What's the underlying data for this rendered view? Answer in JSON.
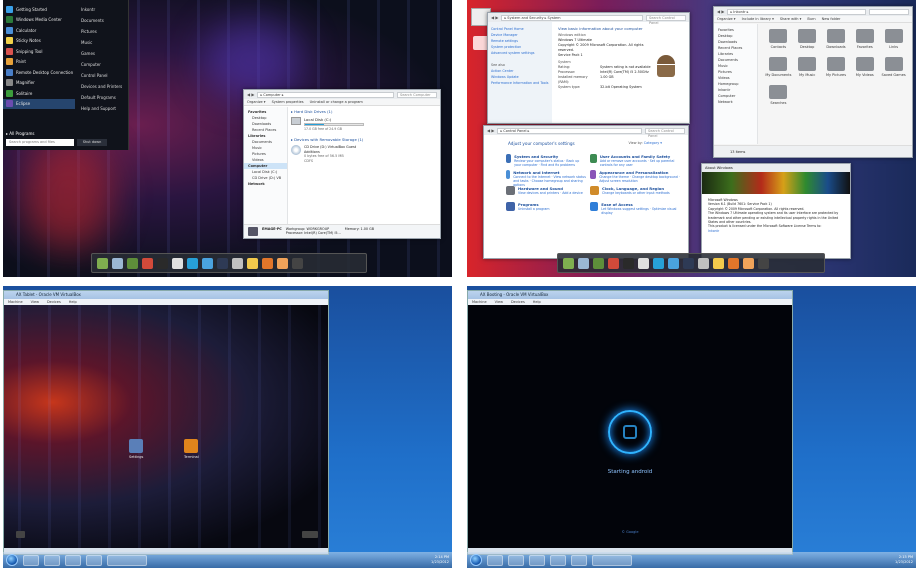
{
  "panel1": {
    "start_menu": {
      "left_items": [
        "Getting Started",
        "Windows Media Center",
        "Calculator",
        "Sticky Notes",
        "Snipping Tool",
        "Paint",
        "Remote Desktop Connection",
        "Magnifier",
        "Solitaire",
        "Eclipse"
      ],
      "all_programs": "All Programs",
      "search_placeholder": "Search programs and files",
      "right_items": [
        "Inkontr",
        "Documents",
        "Pictures",
        "Music",
        "Games",
        "Computer",
        "Control Panel",
        "Devices and Printers",
        "Default Programs",
        "Help and Support"
      ],
      "shutdown": "Shut down"
    },
    "explorer": {
      "address": "▸ Computer ▸",
      "search": "Search Computer",
      "toolbar": [
        "Organize ▾",
        "System properties",
        "Uninstall or change a program"
      ],
      "nav": [
        {
          "label": "Favorites",
          "h": true
        },
        {
          "label": "Desktop",
          "h": false
        },
        {
          "label": "Downloads",
          "h": false
        },
        {
          "label": "Recent Places",
          "h": false
        },
        {
          "label": "Libraries",
          "h": true
        },
        {
          "label": "Documents",
          "h": false
        },
        {
          "label": "Music",
          "h": false
        },
        {
          "label": "Pictures",
          "h": false
        },
        {
          "label": "Videos",
          "h": false
        },
        {
          "label": "Computer",
          "h": true
        },
        {
          "label": "Local Disk (C:)",
          "h": false
        },
        {
          "label": "CD Drive (D:) VB",
          "h": false
        },
        {
          "label": "Network",
          "h": true
        }
      ],
      "hdd_header": "▸ Hard Disk Drives (1)",
      "disk_name": "Local Disk (C:)",
      "disk_free": "17.0 GB free of 24.9 GB",
      "disk_used_fraction": 0.32,
      "removable_header": "▸ Devices with Removable Storage (1)",
      "cd_name": "CD Drive (D:) VirtualBox Guest",
      "cd_sub": "Additions",
      "cd_free": "0 bytes free of 56.5 MB",
      "cd_fs": "CDFS",
      "pc_name": "EMAGE-PC",
      "workgroup": "Workgroup: WORKGROUP",
      "processor": "Processor: Intel(R) Core(TM) i5...",
      "memory": "Memory: 1.00 GB"
    }
  },
  "panel2": {
    "system": {
      "address": "▸ System and Security ▸ System",
      "search": "Search Control Panel",
      "left_links": [
        "Control Panel Home",
        "Device Manager",
        "Remote settings",
        "System protection",
        "Advanced system settings"
      ],
      "see_also": "See also",
      "see_also_links": [
        "Action Center",
        "Windows Update",
        "Performance Information and Tools"
      ],
      "heading": "View basic information about your computer",
      "edition_h": "Windows edition",
      "edition": "Windows 7 Ultimate",
      "copyright": "Copyright © 2009 Microsoft Corporation. All rights reserved.",
      "sp": "Service Pack 1",
      "system_h": "System",
      "rows": [
        [
          "Rating:",
          "System rating is not available"
        ],
        [
          "Processor:",
          "Intel(R) Core(TM) i5 2.50GHz"
        ],
        [
          "Installed memory (RAM):",
          "1.00 GB"
        ],
        [
          "System type:",
          "32-bit Operating System"
        ]
      ]
    },
    "control_panel": {
      "address": "▸ Control Panel ▸",
      "search": "Search Control Panel",
      "heading": "Adjust your computer's settings",
      "view_by": "View by:",
      "category": "Category ▾",
      "left_col": [
        {
          "title": "System and Security",
          "links": "Review your computer's status · Back up your computer · Find and fix problems",
          "color": "#3b6fb6"
        },
        {
          "title": "Network and Internet",
          "links": "Connect to the Internet · View network status and tasks · Choose homegroup and sharing options",
          "color": "#4a8fd6"
        },
        {
          "title": "Hardware and Sound",
          "links": "View devices and printers · Add a device",
          "color": "#6b6f77"
        },
        {
          "title": "Programs",
          "links": "Uninstall a program",
          "color": "#3f63a8"
        }
      ],
      "right_col": [
        {
          "title": "User Accounts and Family Safety",
          "links": "Add or remove user accounts · Set up parental controls for any user",
          "color": "#3d8b52"
        },
        {
          "title": "Appearance and Personalization",
          "links": "Change the theme · Change desktop background · Adjust screen resolution",
          "color": "#8a54b8"
        },
        {
          "title": "Clock, Language, and Region",
          "links": "Change keyboards or other input methods",
          "color": "#d08b2a"
        },
        {
          "title": "Ease of Access",
          "links": "Let Windows suggest settings · Optimize visual display",
          "color": "#2f7ed8"
        }
      ]
    },
    "library": {
      "address": "▸ Inkontr ▸",
      "toolbar": [
        "Organize ▾",
        "Include in library ▾",
        "Share with ▾",
        "Burn",
        "New folder"
      ],
      "nav": [
        "Favorites",
        "Desktop",
        "Downloads",
        "Recent Places",
        "Libraries",
        "Documents",
        "Music",
        "Pictures",
        "Videos",
        "Homegroup",
        "Inkontr",
        "Computer",
        "Network"
      ],
      "items": [
        "Contacts",
        "Desktop",
        "Downloads",
        "Favorites",
        "Links",
        "My Documents",
        "My Music",
        "My Pictures",
        "My Videos",
        "Saved Games",
        "Searches"
      ],
      "status": "13 items"
    },
    "winver": {
      "title": "About Windows",
      "lines": [
        "Microsoft Windows",
        "Version 6.1 (Build 7601: Service Pack 1)",
        "Copyright © 2009 Microsoft Corporation. All rights reserved.",
        "The Windows 7 Ultimate operating system and its user interface are protected by trademark and other pending or existing intellectual property rights in the United States and other countries.",
        "This product is licensed under the Microsoft Software License Terms to:",
        "Inkontr"
      ]
    }
  },
  "panel3": {
    "vm_title": "AX Tablet - Oracle VM VirtualBox",
    "vm_menu": [
      "Machine",
      "View",
      "Devices",
      "Help"
    ],
    "apps": [
      {
        "label": "Settings",
        "color": "#5a7fb8"
      },
      {
        "label": "Terminal",
        "color": "#e0851c"
      }
    ],
    "clock": "2:14 PM",
    "date": "1/23/2012"
  },
  "panel4": {
    "vm_title": "AX Booting - Oracle VM VirtualBox",
    "vm_menu": [
      "Machine",
      "View",
      "Devices",
      "Help"
    ],
    "boot_text": "Starting android",
    "boot_footer": "© Google",
    "clock": "2:15 PM",
    "date": "1/23/2012"
  }
}
